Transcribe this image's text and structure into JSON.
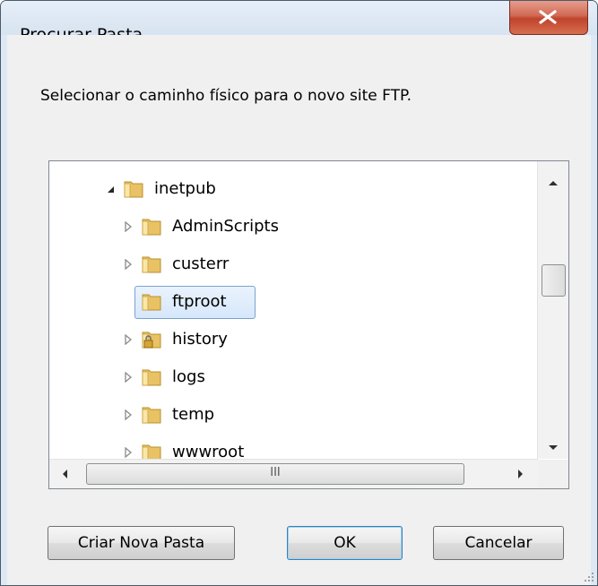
{
  "dialog": {
    "title": "Procurar Pasta",
    "instruction": "Selecionar o caminho físico para o novo site FTP.",
    "close_glyph": "X"
  },
  "tree": {
    "items": [
      {
        "label": "inetpub",
        "icon": "folder-icon",
        "expander": "expanded"
      },
      {
        "label": "AdminScripts",
        "icon": "folder-icon",
        "expander": "collapsed"
      },
      {
        "label": "custerr",
        "icon": "folder-icon",
        "expander": "collapsed"
      },
      {
        "label": "ftproot",
        "icon": "folder-icon",
        "expander": "none",
        "selected": true
      },
      {
        "label": "history",
        "icon": "locked-folder-icon",
        "expander": "collapsed"
      },
      {
        "label": "logs",
        "icon": "folder-icon",
        "expander": "collapsed"
      },
      {
        "label": "temp",
        "icon": "folder-icon",
        "expander": "collapsed"
      },
      {
        "label": "wwwroot",
        "icon": "folder-icon",
        "expander": "collapsed"
      }
    ],
    "hscroll_thumb_grip": "III"
  },
  "buttons": {
    "new_folder": "Criar Nova Pasta",
    "ok": "OK",
    "cancel": "Cancelar"
  },
  "colors": {
    "selection_border": "#7da2ce",
    "close_button": "#c0432d",
    "folder": "#e8c264"
  }
}
